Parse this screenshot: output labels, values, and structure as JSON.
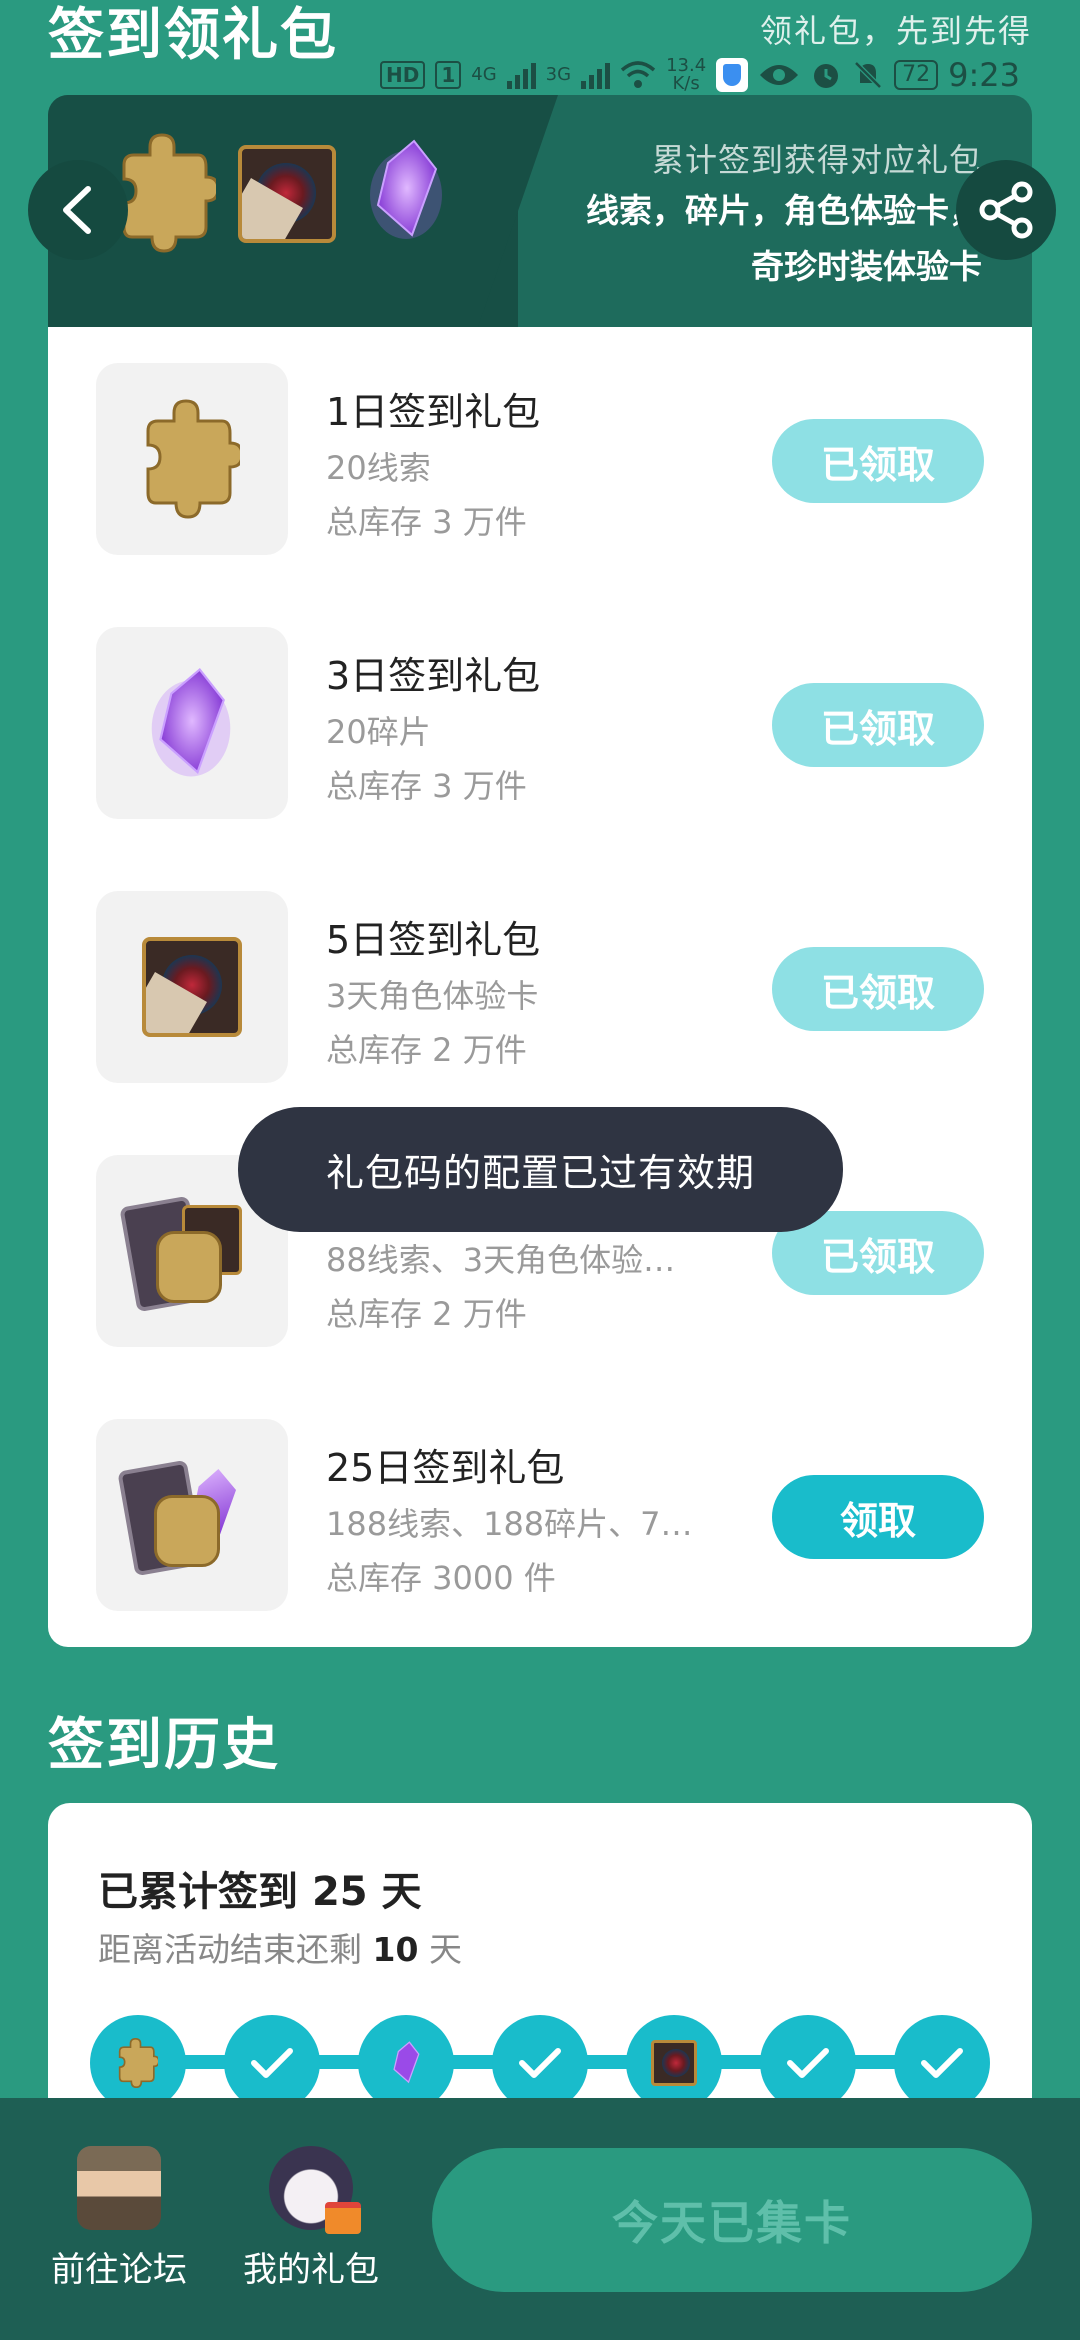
{
  "header": {
    "title": "签到领礼包",
    "slogan": "领礼包，先到先得"
  },
  "status_bar": {
    "hd": "HD",
    "sim": "1",
    "net1": "4G",
    "net2": "3G",
    "speed_value": "13.4",
    "speed_unit": "K/s",
    "battery": "72",
    "time": "9:23"
  },
  "banner": {
    "line1": "累计签到获得对应礼包",
    "line2": "线索，碎片，角色体验卡，奇珍时装体验卡",
    "items": [
      "puzzle-icon",
      "portrait-card-icon",
      "crystal-icon"
    ]
  },
  "rewards": [
    {
      "title": "1日签到礼包",
      "desc": "20线索",
      "stock": "总库存 3 万件",
      "button": "已领取",
      "claimed": true,
      "icon": "puzzle-icon"
    },
    {
      "title": "3日签到礼包",
      "desc": "20碎片",
      "stock": "总库存 3 万件",
      "button": "已领取",
      "claimed": true,
      "icon": "crystal-icon"
    },
    {
      "title": "5日签到礼包",
      "desc": "3天角色体验卡",
      "stock": "总库存 2 万件",
      "button": "已领取",
      "claimed": true,
      "icon": "portrait-card-icon"
    },
    {
      "title": "",
      "desc": "88线索、3天角色体验…",
      "stock": "总库存 2 万件",
      "button": "已领取",
      "claimed": true,
      "icon": "card-bundle-icon"
    },
    {
      "title": "25日签到礼包",
      "desc": "188线索、188碎片、7…",
      "stock": "总库存 3000 件",
      "button": "领取",
      "claimed": false,
      "icon": "card-bundle-crystal-icon"
    }
  ],
  "toast": "礼包码的配置已过有效期",
  "history": {
    "title": "签到历史",
    "cumulative_prefix": "已累计签到",
    "cumulative_days": "25",
    "cumulative_suffix": "天",
    "remaining_prefix": "距离活动结束还剩",
    "remaining_days": "10",
    "remaining_suffix": "天",
    "nodes": [
      "puzzle-icon",
      "check-icon",
      "crystal-icon",
      "check-icon",
      "portrait-card-icon",
      "check-icon",
      "check-icon"
    ]
  },
  "bottom_bar": {
    "forum_label": "前往论坛",
    "gifts_label": "我的礼包",
    "today_button": "今天已集卡"
  },
  "colors": {
    "background": "#2a9a80",
    "accent": "#19bccb",
    "claimed": "#8ee0e4",
    "toast": "#2f3442"
  }
}
